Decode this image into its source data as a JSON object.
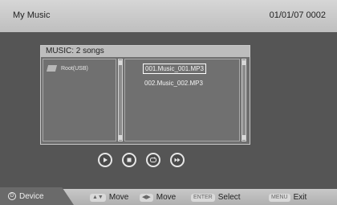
{
  "topbar": {
    "title": "My Music",
    "datetime": "01/01/07  0002"
  },
  "panel": {
    "header": "MUSIC: 2 songs",
    "directories": [
      "Root(USB)"
    ],
    "files": [
      "001.Music_001.MP3",
      "002.Music_002.MP3"
    ],
    "selected_index": 0
  },
  "controls": {
    "play_icon": "play-icon",
    "stop_icon": "stop-icon",
    "repeat_icon": "repeat-icon",
    "next_icon": "fast-forward-icon"
  },
  "bottombar": {
    "device_badge": "D",
    "device_label": "Device",
    "move_vertical_key": "▲▼",
    "move_vertical_label": "Move",
    "move_horizontal_key": "◀▶",
    "move_horizontal_label": "Move",
    "enter_key": "ENTER",
    "enter_label": "Select",
    "menu_key": "MENU",
    "menu_label": "Exit"
  },
  "colors": {
    "background": "#4a4a4a",
    "panel": "#6e6e6e",
    "bars": "#c4c4c4"
  }
}
